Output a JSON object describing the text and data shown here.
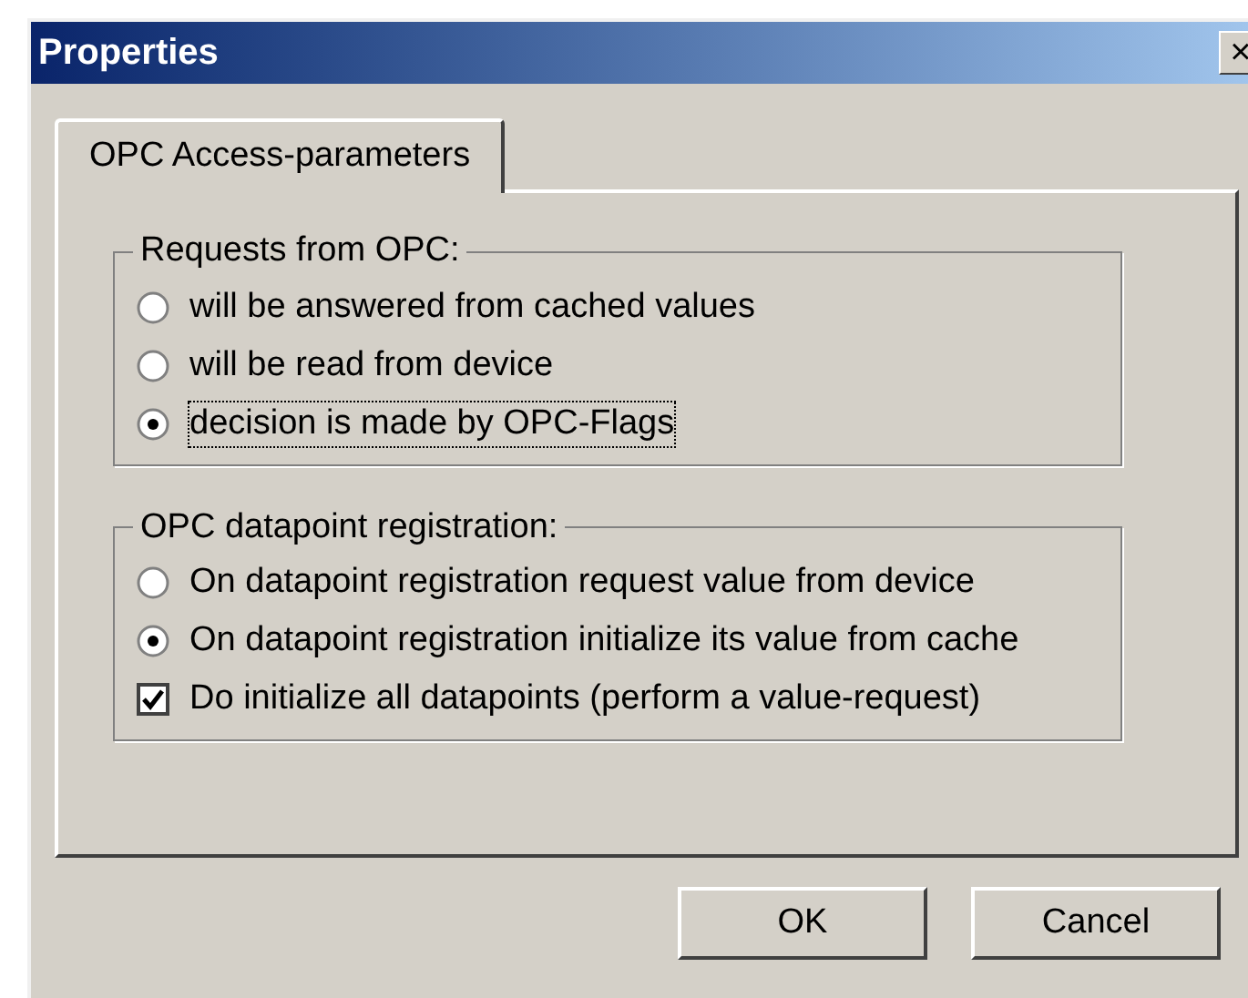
{
  "window": {
    "title": "Properties",
    "close": "×"
  },
  "tabs": [
    {
      "label": "OPC Access-parameters",
      "selected": true
    }
  ],
  "groups": [
    {
      "title": "Requests from OPC:",
      "options": [
        {
          "kind": "radio",
          "label": "will be answered from cached values",
          "selected": false,
          "focused": false
        },
        {
          "kind": "radio",
          "label": "will be read from device",
          "selected": false,
          "focused": false
        },
        {
          "kind": "radio",
          "label": "decision is made by OPC-Flags",
          "selected": true,
          "focused": true
        }
      ]
    },
    {
      "title": "OPC datapoint registration:",
      "options": [
        {
          "kind": "radio",
          "label": "On datapoint registration request value from device",
          "selected": false,
          "focused": false
        },
        {
          "kind": "radio",
          "label": "On datapoint registration initialize its value from cache",
          "selected": true,
          "focused": false
        },
        {
          "kind": "checkbox",
          "label": "Do initialize all datapoints (perform a value-request)",
          "checked": true,
          "focused": false
        }
      ]
    }
  ],
  "buttons": [
    {
      "label": "OK"
    },
    {
      "label": "Cancel"
    }
  ]
}
